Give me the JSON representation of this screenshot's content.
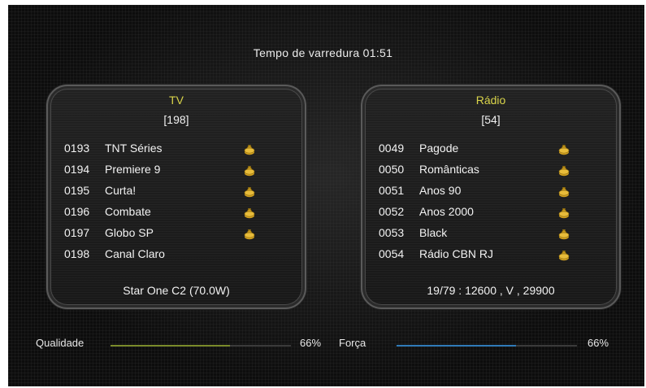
{
  "scan_time": "Tempo de varredura  01:51",
  "tv": {
    "title": "TV",
    "count": "[198]",
    "channels": [
      {
        "num": "0193",
        "name": "TNT Séries",
        "icon": "coin-bag-icon",
        "scrambled": true
      },
      {
        "num": "0194",
        "name": "Premiere 9",
        "icon": "coin-bag-icon",
        "scrambled": true
      },
      {
        "num": "0195",
        "name": "Curta!",
        "icon": "coin-bag-icon",
        "scrambled": true
      },
      {
        "num": "0196",
        "name": "Combate",
        "icon": "coin-bag-icon",
        "scrambled": true
      },
      {
        "num": "0197",
        "name": "Globo SP",
        "icon": "coin-bag-icon",
        "scrambled": true
      },
      {
        "num": "0198",
        "name": "Canal Claro",
        "scrambled": false
      }
    ],
    "footer": "Star One C2  (70.0W)"
  },
  "radio": {
    "title": "Rádio",
    "count": "[54]",
    "channels": [
      {
        "num": "0049",
        "name": "Pagode",
        "icon": "coin-bag-icon",
        "scrambled": true
      },
      {
        "num": "0050",
        "name": "Românticas",
        "icon": "coin-bag-icon",
        "scrambled": true
      },
      {
        "num": "0051",
        "name": "Anos 90",
        "icon": "coin-bag-icon",
        "scrambled": true
      },
      {
        "num": "0052",
        "name": "Anos 2000",
        "icon": "coin-bag-icon",
        "scrambled": true
      },
      {
        "num": "0053",
        "name": "Black",
        "icon": "coin-bag-icon",
        "scrambled": true
      },
      {
        "num": "0054",
        "name": "Rádio CBN RJ",
        "icon": "coin-bag-icon",
        "scrambled": true
      }
    ],
    "footer": "19/79 : 12600 , V , 29900"
  },
  "signal": {
    "quality_label": "Qualidade",
    "quality_value": "66%",
    "quality_fraction": 0.66,
    "quality_color": "#7a8a2a",
    "strength_label": "Força",
    "strength_value": "66%",
    "strength_fraction": 0.66,
    "strength_color": "#2f7ab8"
  },
  "colors": {
    "title_accent": "#d9d44a",
    "coin_gold": "#d4a21e"
  }
}
